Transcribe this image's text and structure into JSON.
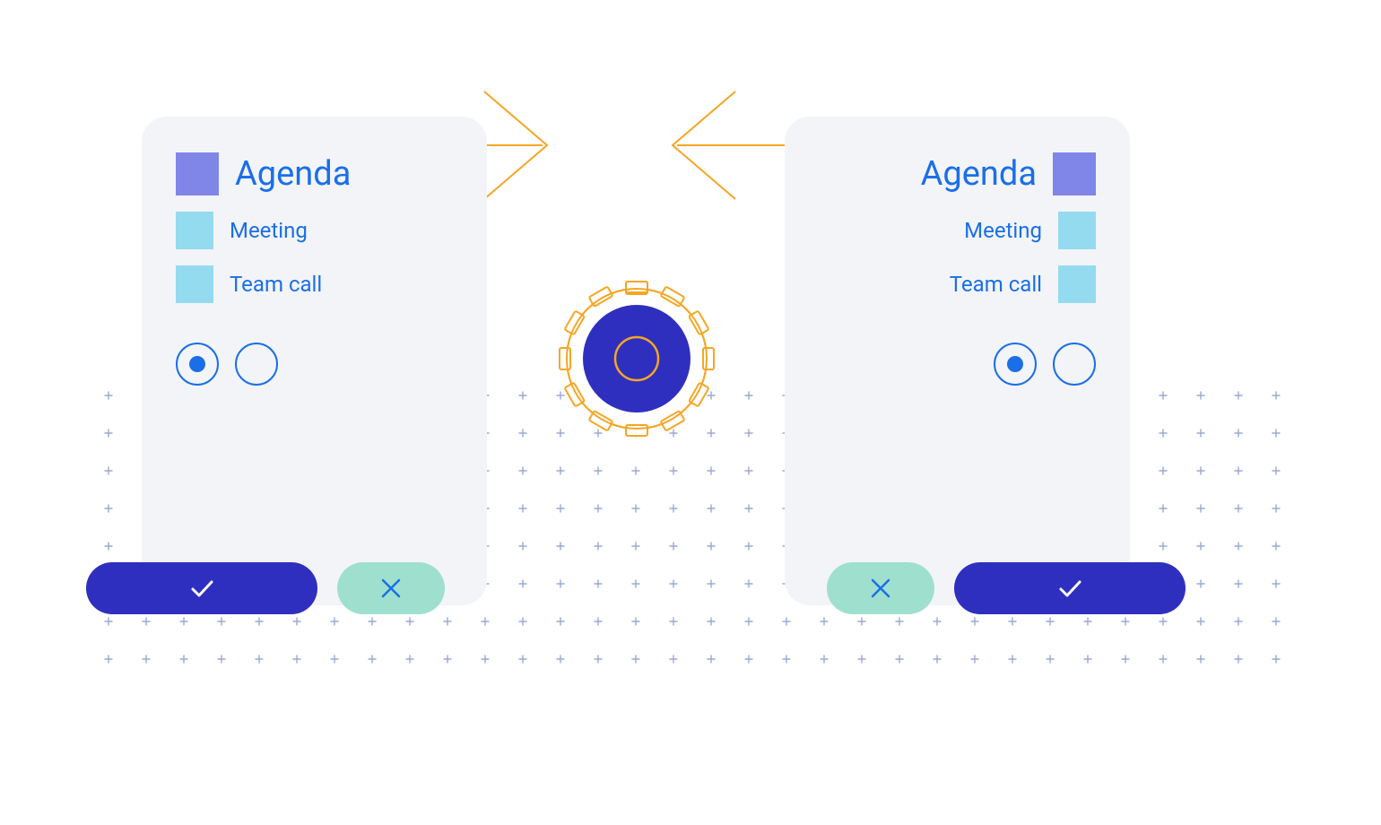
{
  "colors": {
    "blue_text": "#1a6fe8",
    "violet_square": "#7f86e8",
    "cyan_square": "#94dbf0",
    "confirm_bg": "#2f2fbf",
    "cancel_bg": "#9ee0cd",
    "orange": "#f5a623",
    "dot": "#9aa8d6"
  },
  "left_card": {
    "direction": "ltr",
    "heading": "Agenda",
    "items": [
      "Meeting",
      "Team call"
    ],
    "radio_selected_index": 0
  },
  "right_card": {
    "direction": "rtl",
    "heading": "Agenda",
    "items": [
      "Meeting",
      "Team call"
    ],
    "radio_selected_index": 1
  },
  "icons": {
    "confirm": "check-icon",
    "cancel": "x-icon",
    "gear": "gear-icon",
    "arrow_right": "arrow-right-icon",
    "arrow_left": "arrow-left-icon"
  }
}
